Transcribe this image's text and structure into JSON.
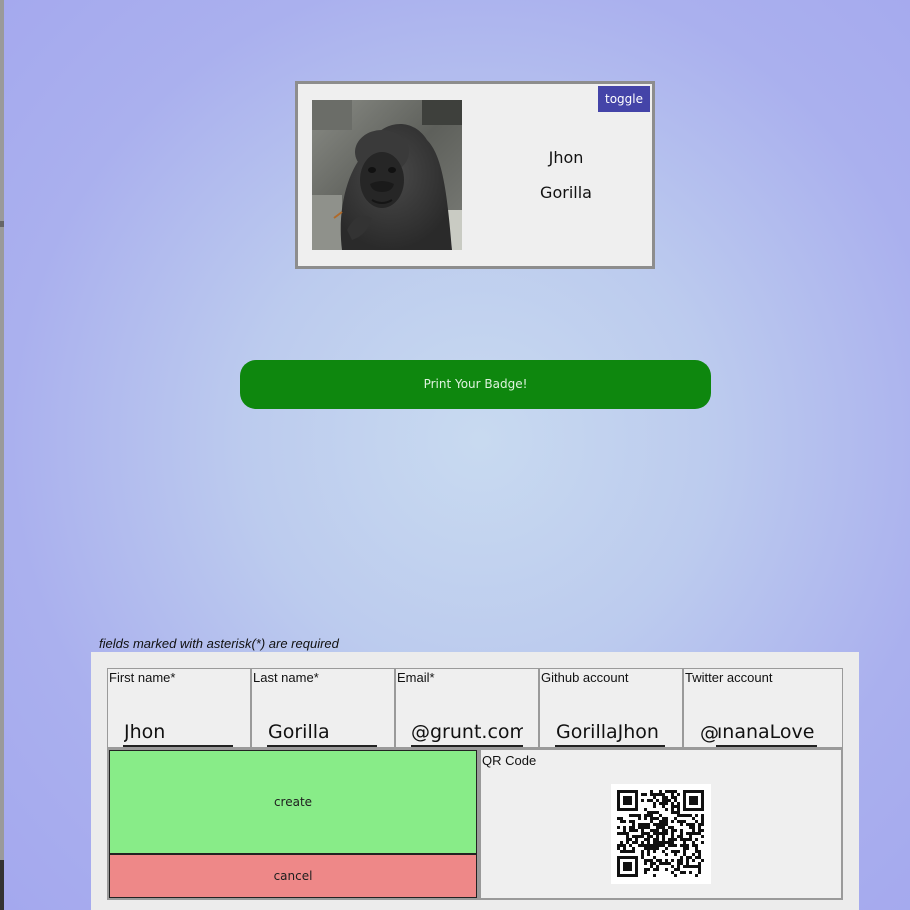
{
  "badge": {
    "toggle_label": "toggle",
    "first_name": "Jhon",
    "last_name": "Gorilla",
    "photo_subject": "gorilla"
  },
  "print_label": "Print Your Badge!",
  "required_note": "fields marked with asterisk(*) are required",
  "form": {
    "fields": [
      {
        "label": "First name*",
        "value": "Jhon"
      },
      {
        "label": "Last name*",
        "value": "Gorilla"
      },
      {
        "label": "Email*",
        "value": "@grunt.com"
      },
      {
        "label": "Github account",
        "value": "GorillaJhon"
      },
      {
        "label": "Twitter account",
        "prefix": "@",
        "value": "ınanaLover"
      }
    ],
    "create_label": "create",
    "cancel_label": "cancel",
    "qr_label": "QR Code"
  },
  "colors": {
    "toggle_bg": "#4444a8",
    "print_bg": "#0e870e",
    "create_bg": "#88ec88",
    "cancel_bg": "#ee8888"
  }
}
